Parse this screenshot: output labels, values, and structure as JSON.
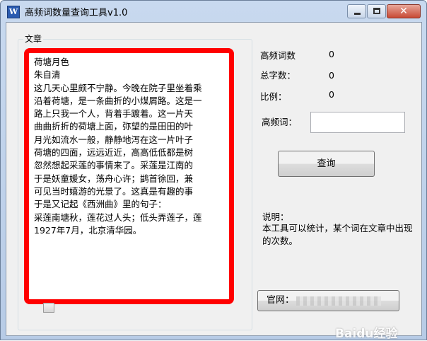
{
  "window": {
    "title": "高频词数量查询工具v1.0",
    "app_icon": "W",
    "close_glyph": "✕"
  },
  "article": {
    "group_label": "文章",
    "lines": [
      "荷塘月色",
      "朱自清",
      "这几天心里颇不宁静。今晚在院子里坐着乘",
      "沿着荷塘，是一条曲折的小煤屑路。这是一",
      "路上只我一个人，背着手踱着。这一片天",
      "曲曲折折的荷塘上面，弥望的是田田的叶",
      "月光如流水一般，静静地泻在这一片叶子",
      "荷塘的四面，远远近近，高高低低都是树",
      "忽然想起采莲的事情来了。采莲是江南的",
      "于是妖童媛女，荡舟心许；鹢首徐回，兼",
      "可见当时嬉游的光景了。这真是有趣的事",
      "于是又记起《西洲曲》里的句子：",
      "采莲南塘秋，莲花过人头；低头弄莲子，莲",
      "1927年7月，北京清华园。"
    ]
  },
  "stats": {
    "freq_label": "高频词数",
    "freq_value": "0",
    "total_label": "总字数：",
    "total_value": "0",
    "ratio_label": "比例：",
    "ratio_value": "0"
  },
  "query": {
    "input_label": "高频词：",
    "input_value": "",
    "button_label": "查询"
  },
  "note": {
    "title": "说明：",
    "body": "本工具可以统计，某个词在文章中出现的次数。"
  },
  "site_button": {
    "label": "官网："
  },
  "watermark": {
    "text": "Baidu经验"
  },
  "colors": {
    "highlight": "#ff0000",
    "titlebar": "#c8d9ef",
    "close": "#c84a35"
  }
}
